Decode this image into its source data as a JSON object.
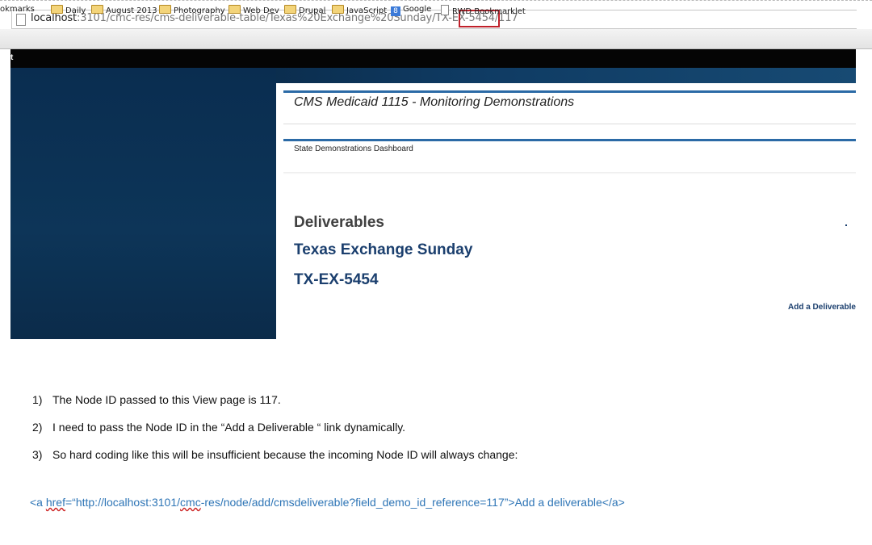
{
  "browser": {
    "url_host": "localhost",
    "url_path": ":3101/cmc-res/cms-deliverable-table/Texas%20Exchange%20Sunday/TX-EX-5454/117",
    "bookmarks": [
      "okmarks",
      "Daily",
      "August 2013",
      "Photography",
      "Web Dev",
      "Drupal",
      "JavaScript",
      "Google",
      "RWD Bookmarklet"
    ]
  },
  "site": {
    "topbar_letter": "t",
    "title": "CMS Medicaid 1115 - Monitoring Demonstrations",
    "breadcrumb": "State Demonstrations Dashboard",
    "heading": "Deliverables",
    "demo_name": "Texas Exchange Sunday",
    "demo_id": "TX-EX-5454",
    "add_link": "Add a Deliverable"
  },
  "notes": [
    {
      "num": "1)",
      "text": "The Node ID passed to this View page is 117."
    },
    {
      "num": "2)",
      "text": "I need to pass the Node ID in the “Add a Deliverable “ link dynamically."
    },
    {
      "num": "3)",
      "text": "So  hard coding like this will be insufficient because the incoming Node ID will always change:"
    }
  ],
  "code": {
    "part1": "<a ",
    "href_word": "href",
    "part2": "=“http://localhost:3101/",
    "cmc_word": "cmc",
    "part3": "-res/node/add/cmsdeliverable?field_demo_id_reference=117”>Add a deliverable</a>"
  },
  "colors": {
    "highlight_box": "#c0202a",
    "link_blue": "#1b3f6e",
    "code_blue": "#2e75b6"
  }
}
